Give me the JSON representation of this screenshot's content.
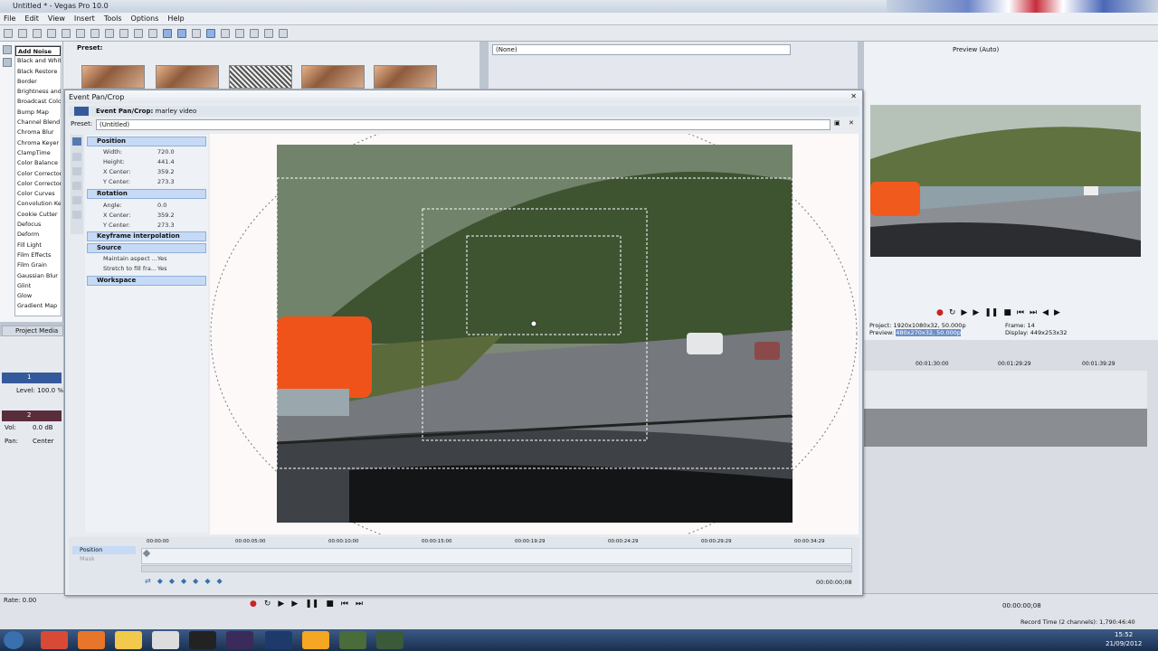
{
  "app": {
    "title": "Untitled * - Vegas Pro 10.0"
  },
  "menu": [
    "File",
    "Edit",
    "View",
    "Insert",
    "Tools",
    "Options",
    "Help"
  ],
  "fx_list": {
    "items": [
      "Add Noise",
      "Black and White",
      "Black Restore",
      "Border",
      "Brightness and Contrast",
      "Broadcast Colors",
      "Bump Map",
      "Channel Blend",
      "Chroma Blur",
      "Chroma Keyer",
      "ClampTime",
      "Color Balance",
      "Color Corrector",
      "Color Corrector",
      "Color Curves",
      "Convolution Kernel",
      "Cookie Cutter",
      "Defocus",
      "Deform",
      "Fill Light",
      "Film Effects",
      "Film Grain",
      "Gaussian Blur",
      "Glint",
      "Glow",
      "Gradient Map"
    ],
    "selected": 0,
    "tab_label": "Project Media"
  },
  "preset_strip": {
    "label": "Preset:"
  },
  "trimmer": {
    "selection": "(None)"
  },
  "preview": {
    "mode": "Preview (Auto)",
    "project_label": "Project:",
    "project_value": "1920x1080x32, 50.000p",
    "preview_label": "Preview:",
    "preview_value": "480x270x32, 50.000p",
    "frame_label": "Frame:",
    "frame_value": "14",
    "display_label": "Display:",
    "display_value": "449x253x32"
  },
  "right_timeline": {
    "ticks": [
      "00:01:30:00",
      "00:01:29:29",
      "00:01:39:29"
    ]
  },
  "tracks": {
    "track1": {
      "num": "1",
      "level_label": "Level:",
      "level_value": "100.0 %"
    },
    "track2": {
      "num": "2",
      "vol_label": "Vol:",
      "vol_value": "0.0 dB",
      "pan_label": "Pan:",
      "pan_value": "Center"
    }
  },
  "dialog": {
    "title": "Event Pan/Crop",
    "subtitle_bold": "Event Pan/Crop:",
    "subtitle_name": "marley video",
    "preset_label": "Preset:",
    "preset_value": "(Untitled)",
    "groups": {
      "position": "Position",
      "rotation": "Rotation",
      "keyframe": "Keyframe interpolation",
      "source": "Source",
      "workspace": "Workspace"
    },
    "props": {
      "width_label": "Width:",
      "width_value": "720.0",
      "height_label": "Height:",
      "height_value": "441.4",
      "xc_label": "X Center:",
      "xc_value": "359.2",
      "yc_label": "Y Center:",
      "yc_value": "273.3",
      "angle_label": "Angle:",
      "angle_value": "0.0",
      "rxc_label": "X Center:",
      "rxc_value": "359.2",
      "ryc_label": "Y Center:",
      "ryc_value": "273.3",
      "maintain_label": "Maintain aspect ...",
      "maintain_value": "Yes",
      "stretch_label": "Stretch to fill fra...",
      "stretch_value": "Yes"
    },
    "kf": {
      "track_position": "Position",
      "track_mask": "Mask",
      "ticks": [
        "00:00:00",
        "00:00:05:00",
        "00:00:10:00",
        "00:00:15:00",
        "00:00:19:29",
        "00:00:24:29",
        "00:00:29:29",
        "00:00:34:29"
      ],
      "time": "00:00:00;08"
    }
  },
  "status": {
    "rate_label": "Rate: 0.00",
    "time_right": "00:00:00;08",
    "record_time": "Record Time (2 channels): 1,790:46:40"
  },
  "clock": {
    "time": "15:52",
    "date": "21/09/2012"
  }
}
